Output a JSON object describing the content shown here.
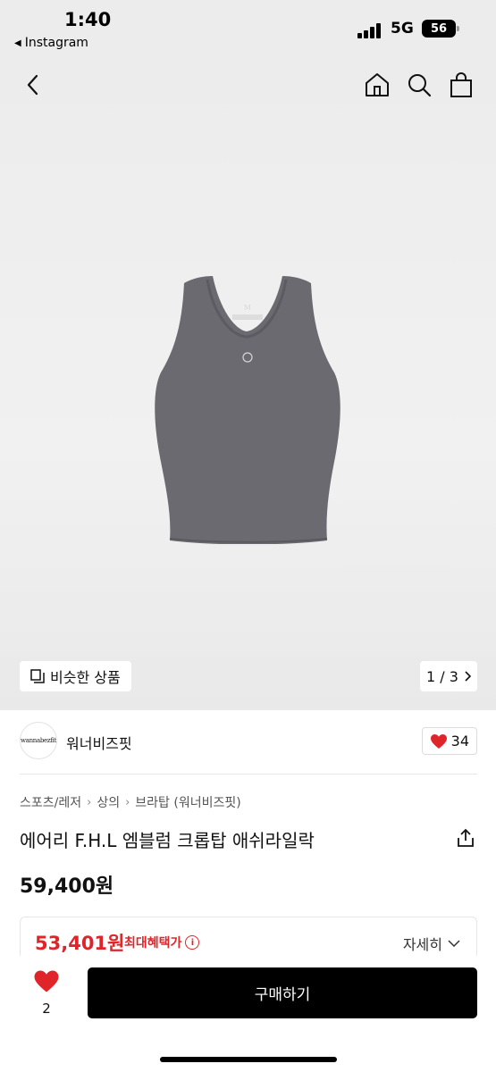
{
  "status_bar": {
    "time": "1:40",
    "back_app": "Instagram",
    "network": "5G",
    "battery": "56"
  },
  "header": {
    "icons": [
      "back-chevron-icon",
      "home-icon",
      "search-icon",
      "shopping-bag-icon"
    ]
  },
  "gallery": {
    "similar_label": "비슷한 상품",
    "pager": "1 / 3"
  },
  "brand": {
    "name": "워너비즈핏",
    "logo_text": "wannabezfit",
    "like_count": "34"
  },
  "product": {
    "breadcrumb": [
      "스포츠/레저",
      "상의",
      "브라탑 (워너비즈핏)"
    ],
    "title": "에어리 F.H.L 엠블럼 크롭탑 애쉬라일락",
    "price": "59,400원",
    "benefit_price": "53,401원",
    "benefit_label": "최대혜택가",
    "detail_label": "자세히"
  },
  "bottom_bar": {
    "favorite_count": "2",
    "buy_label": "구매하기"
  },
  "colors": {
    "accent_red": "#e0252a",
    "button_black": "#000000"
  }
}
